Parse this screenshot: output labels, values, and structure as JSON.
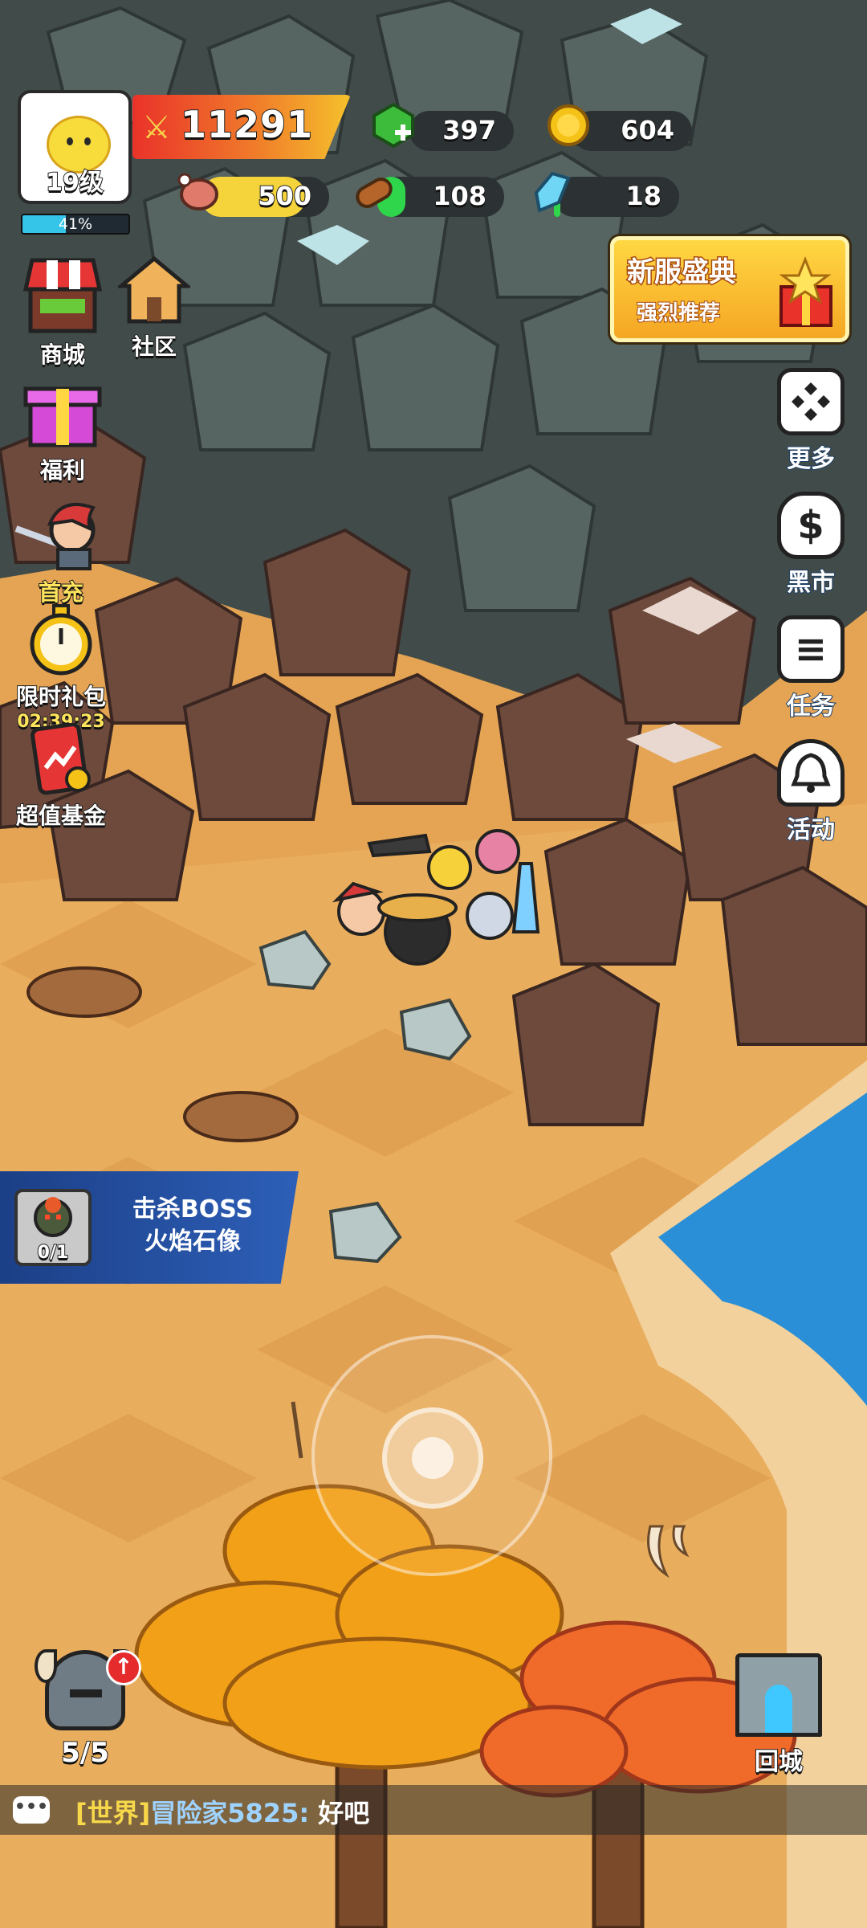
{
  "player": {
    "level_label": "19级",
    "xp_percent_label": "41%",
    "xp_fraction": 0.41
  },
  "power": {
    "value": "11291",
    "icon": "crossed-swords-icon"
  },
  "resources": {
    "gems": {
      "value": "397",
      "icon": "green-gem-plus-icon",
      "color": "#3dbb3a"
    },
    "gold": {
      "value": "604",
      "icon": "gold-coin-icon",
      "color": "#f5c218"
    },
    "meat": {
      "value": "500",
      "icon": "meat-icon",
      "color": "#f5d43b",
      "fill": 0.82
    },
    "wood": {
      "value": "108",
      "icon": "log-icon",
      "color": "#2fd54a",
      "fill": 0.22
    },
    "crystal": {
      "value": "18",
      "icon": "blue-crystal-icon",
      "color": "#2fd54a",
      "fill": 0.05
    }
  },
  "left_menu": {
    "shop": {
      "label": "商城",
      "icon": "shop-stall-icon"
    },
    "community": {
      "label": "社区",
      "icon": "house-icon"
    },
    "welfare": {
      "label": "福利",
      "icon": "gift-box-icon"
    },
    "first_charge": {
      "label": "首充",
      "icon": "red-haired-warrior-icon"
    },
    "limited_pack": {
      "label": "限时礼包",
      "timer": "02:39:23",
      "icon": "stopwatch-icon"
    },
    "value_fund": {
      "label": "超值基金",
      "icon": "fund-card-icon"
    }
  },
  "promo": {
    "title": "新服盛典",
    "subtitle": "强烈推荐",
    "icon": "gift-pile-icon"
  },
  "right_menu": {
    "more": {
      "label": "更多",
      "icon": "four-diamonds-icon"
    },
    "black_market": {
      "label": "黑市",
      "icon": "money-bag-icon"
    },
    "tasks": {
      "label": "任务",
      "icon": "list-menu-icon"
    },
    "events": {
      "label": "活动",
      "icon": "bell-icon"
    }
  },
  "quest": {
    "progress": "0/1",
    "title_line1": "击杀BOSS",
    "title_line2": "火焰石像",
    "icon": "stone-golem-boss-icon"
  },
  "heroes": {
    "count": "5/5",
    "icon": "horned-helmet-icon",
    "upgrade_icon": "red-up-arrow-icon"
  },
  "return_city": {
    "label": "回城",
    "icon": "castle-portal-icon"
  },
  "chat": {
    "channel": "[世界]",
    "sender": "冒险家5825:",
    "message": "好吧",
    "icon": "chat-bubble-icon"
  },
  "colors": {
    "cliff": "#5a4a42",
    "stone": "#4b5654",
    "sand": "#e8a95a",
    "sea": "#2a8fd6",
    "accent": "#e9322a"
  }
}
